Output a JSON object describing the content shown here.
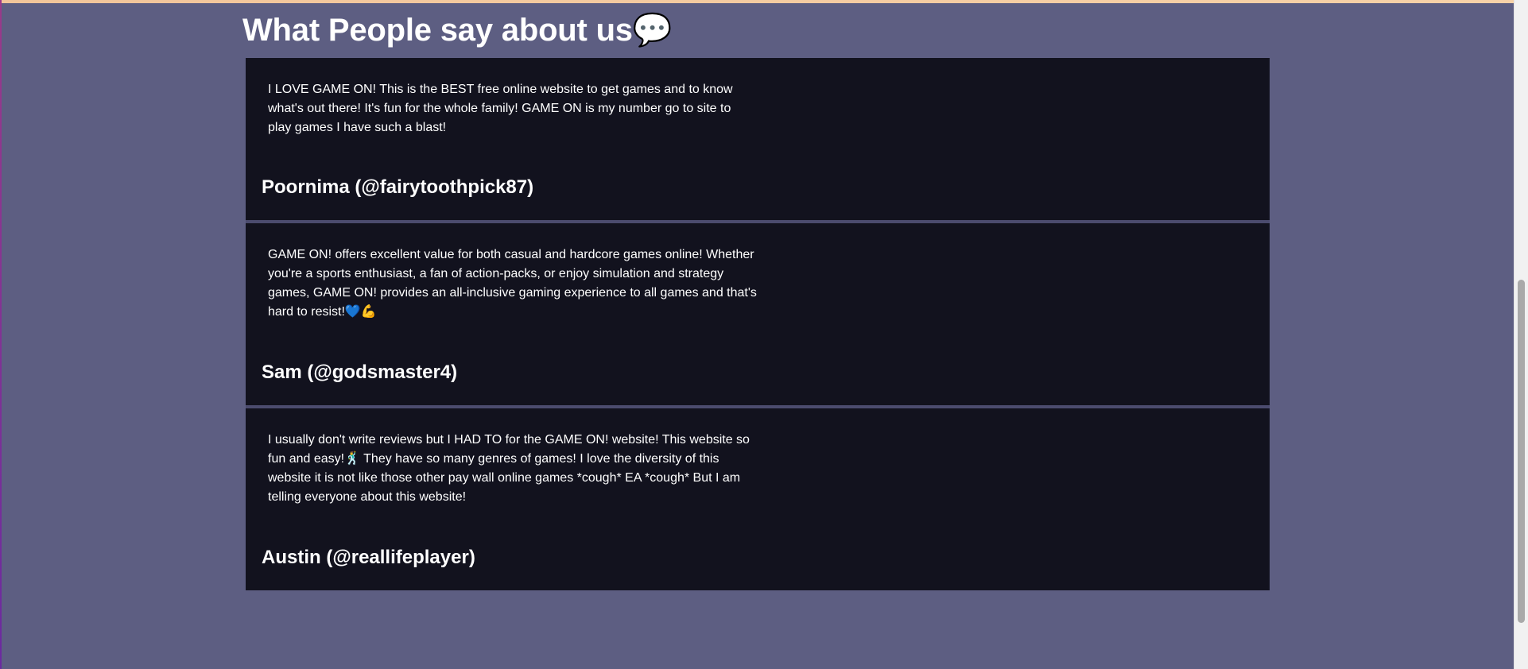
{
  "page": {
    "title": "What People say about us💬"
  },
  "reviews": [
    {
      "text": "I LOVE GAME ON! This is the BEST free online website to get games and to know what's out there! It's fun for the whole family! GAME ON is my number go to site to play games I have such a blast!",
      "author": "Poornima (@fairytoothpick87)"
    },
    {
      "text": "GAME ON! offers excellent value for both casual and hardcore games online! Whether you're a sports enthusiast, a fan of action-packs, or enjoy simulation and strategy games, GAME ON! provides an all-inclusive gaming experience to all games and that's hard to resist!💙💪",
      "author": "Sam (@godsmaster4)"
    },
    {
      "text": "I usually don't write reviews but I HAD TO for the GAME ON! website! This website so fun and easy!🕺 They have so many genres of games! I love the diversity of this website it is not like those other pay wall online games *cough* EA *cough* But I am telling everyone about this website!",
      "author": "Austin (@reallifeplayer)"
    }
  ],
  "colors": {
    "page_background": "#5d5e82",
    "card_background": "#12121e",
    "text": "#ffffff"
  }
}
